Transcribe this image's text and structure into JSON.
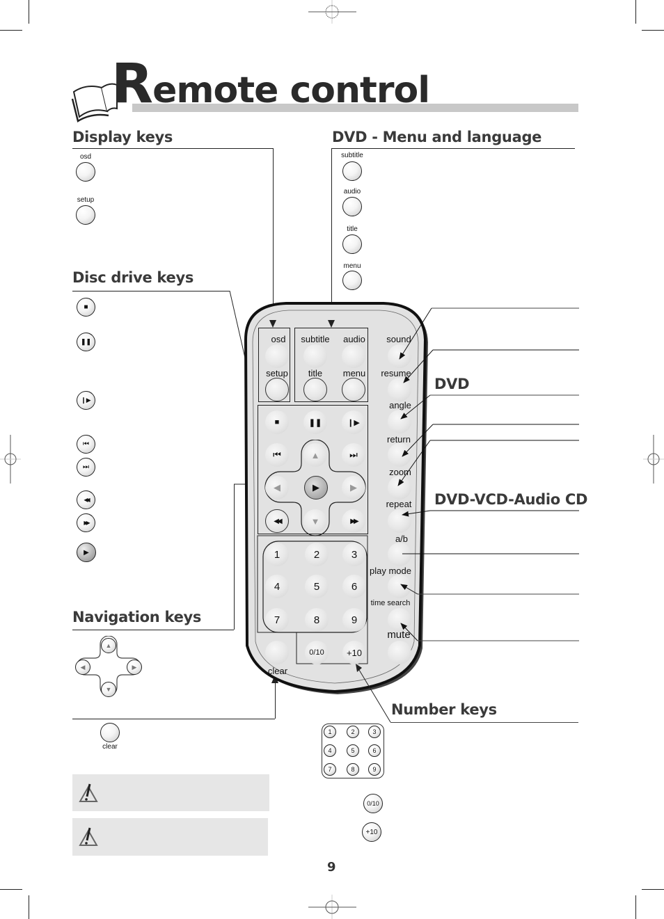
{
  "page": {
    "title_initial": "R",
    "title_rest": "emote control",
    "page_number": "9"
  },
  "sections": {
    "display_keys": {
      "heading": "Display keys",
      "keys": [
        {
          "label": "osd"
        },
        {
          "label": "setup"
        }
      ]
    },
    "dvd_menu_language": {
      "heading": "DVD - Menu and language",
      "keys": [
        {
          "label": "subtitle"
        },
        {
          "label": "audio"
        },
        {
          "label": "title"
        },
        {
          "label": "menu"
        }
      ]
    },
    "disc_drive_keys": {
      "heading": "Disc drive keys",
      "keys": [
        {
          "icon": "stop-icon",
          "glyph": "■"
        },
        {
          "icon": "pause-icon",
          "glyph": "❚❚"
        },
        {
          "icon": "step-play-icon",
          "glyph": "❙▶"
        },
        {
          "icon": "previous-icon",
          "glyph": "⏮"
        },
        {
          "icon": "next-icon",
          "glyph": "⏭"
        },
        {
          "icon": "rewind-icon",
          "glyph": "◀◀"
        },
        {
          "icon": "fast-forward-icon",
          "glyph": "▶▶"
        },
        {
          "icon": "play-icon",
          "glyph": "▶"
        }
      ]
    },
    "navigation_keys": {
      "heading": "Navigation keys",
      "arrows": {
        "up": "▲",
        "down": "▼",
        "left": "◀",
        "right": "▶"
      },
      "clear_label": "clear"
    },
    "dvd": {
      "heading": "DVD"
    },
    "dvd_vcd_audio_cd": {
      "heading": "DVD-VCD-Audio CD"
    },
    "number_keys": {
      "heading": "Number keys",
      "digits": [
        "1",
        "2",
        "3",
        "4",
        "5",
        "6",
        "7",
        "8",
        "9"
      ],
      "extra": [
        "0/10",
        "+10"
      ]
    }
  },
  "remote": {
    "top_keys": {
      "osd": "osd",
      "setup": "setup",
      "subtitle": "subtitle",
      "audio": "audio",
      "title": "title",
      "menu": "menu"
    },
    "side_keys": [
      "sound",
      "resume",
      "angle",
      "return",
      "zoom",
      "repeat",
      "a/b",
      "play mode",
      "time search",
      "mute"
    ],
    "transport": {
      "stop": "■",
      "pause": "❚❚",
      "step": "❙▶",
      "prev": "⏮",
      "next": "⏭",
      "rew": "◀◀",
      "ff": "▶▶",
      "play": "▶",
      "up": "▲",
      "down": "▼",
      "left": "◀",
      "right": "▶"
    },
    "digits": [
      "1",
      "2",
      "3",
      "4",
      "5",
      "6",
      "7",
      "8",
      "9"
    ],
    "zero_ten": "0/10",
    "plus_ten": "+10",
    "clear": "clear"
  },
  "notes": [
    {
      "icon": "warning-icon"
    },
    {
      "icon": "warning-icon"
    }
  ]
}
